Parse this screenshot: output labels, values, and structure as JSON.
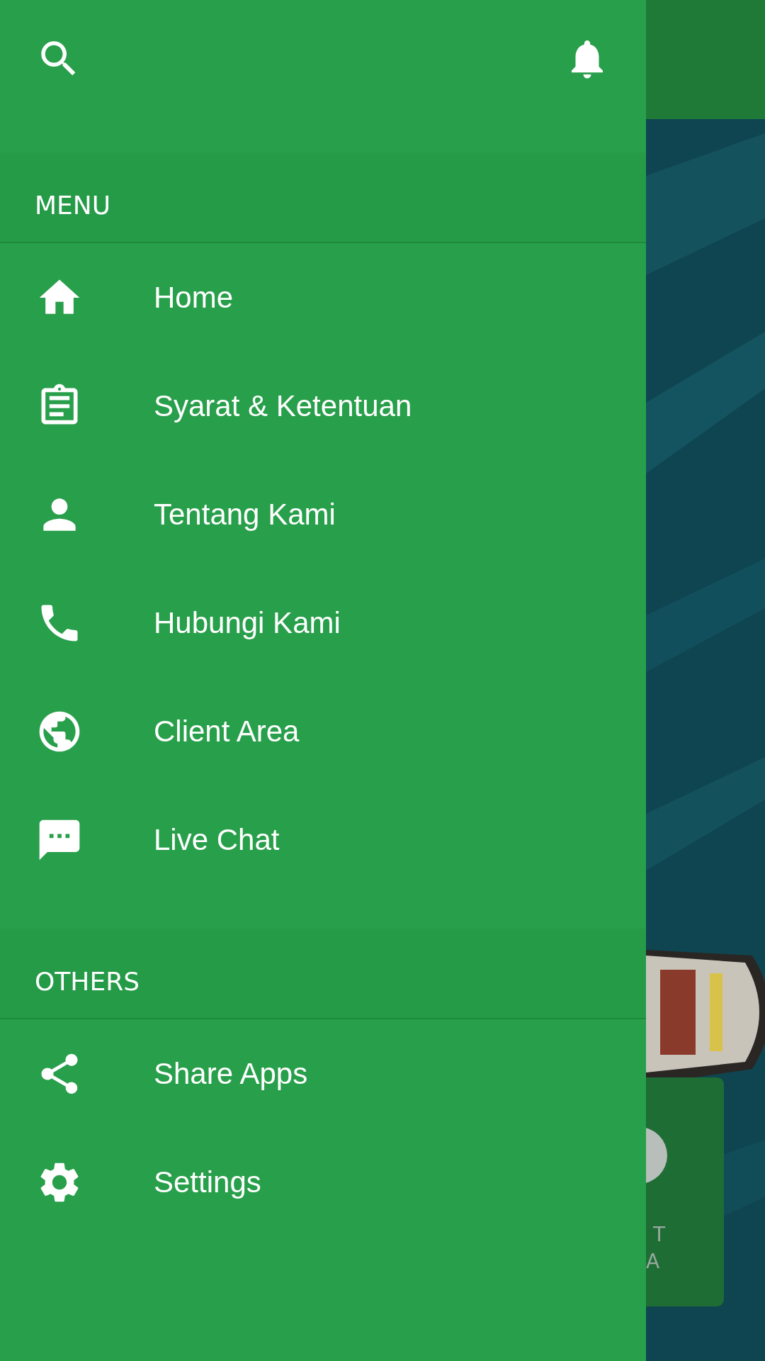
{
  "sections": [
    {
      "title": "MENU",
      "items": [
        {
          "label": "Home"
        },
        {
          "label": "Syarat & Ketentuan"
        },
        {
          "label": "Tentang Kami"
        },
        {
          "label": "Hubungi Kami"
        },
        {
          "label": "Client Area"
        },
        {
          "label": "Live Chat"
        }
      ]
    },
    {
      "title": "OTHERS",
      "items": [
        {
          "label": "Share Apps"
        },
        {
          "label": "Settings"
        }
      ]
    }
  ],
  "background": {
    "card": {
      "texts": [
        "T",
        "A"
      ]
    }
  }
}
